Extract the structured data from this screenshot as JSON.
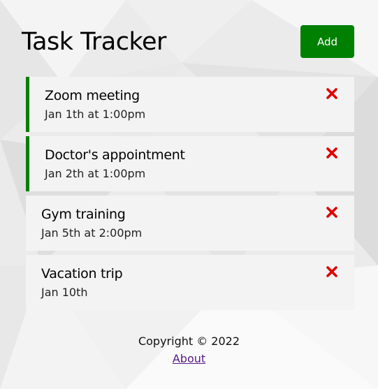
{
  "header": {
    "title": "Task Tracker",
    "add_label": "Add"
  },
  "colors": {
    "accent": "#008000",
    "delete": "#e00000",
    "card": "#f3f3f3",
    "link": "#551a8b"
  },
  "tasks": [
    {
      "text": "Zoom meeting",
      "day": "Jan 1th at 1:00pm",
      "reminder": true,
      "delete_icon": "close-icon"
    },
    {
      "text": "Doctor's appointment",
      "day": "Jan 2th at 1:00pm",
      "reminder": true,
      "delete_icon": "close-icon"
    },
    {
      "text": "Gym training",
      "day": "Jan 5th at 2:00pm",
      "reminder": false,
      "delete_icon": "close-icon"
    },
    {
      "text": "Vacation trip",
      "day": "Jan 10th",
      "reminder": false,
      "delete_icon": "close-icon"
    }
  ],
  "footer": {
    "copyright": "Copyright © 2022",
    "about_label": "About"
  }
}
